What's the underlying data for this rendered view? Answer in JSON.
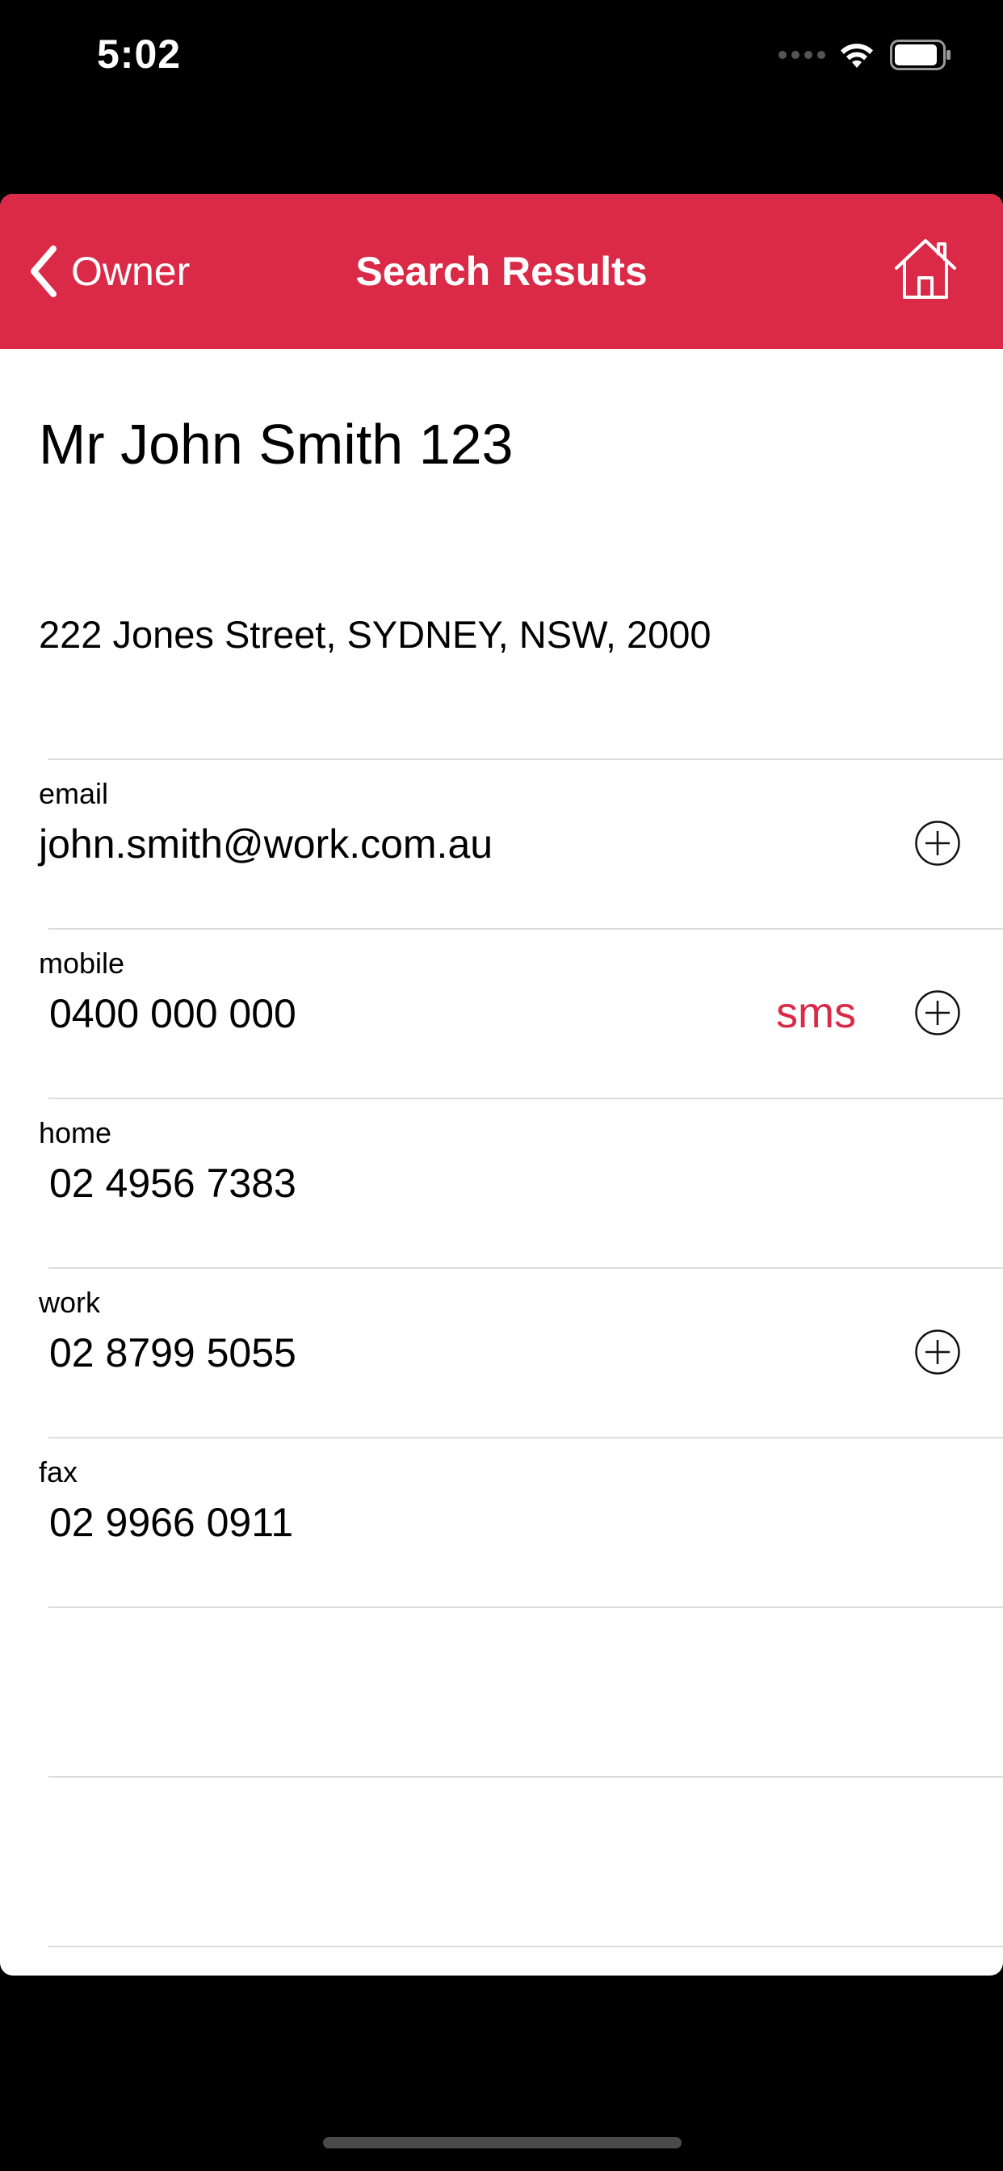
{
  "status_bar": {
    "time": "5:02"
  },
  "nav": {
    "back_label": "Owner",
    "title": "Search Results",
    "accent_color": "#da2a47"
  },
  "owner": {
    "name": "Mr John Smith 123",
    "address": "222 Jones Street, SYDNEY, NSW, 2000"
  },
  "contacts": {
    "email": {
      "label": "email",
      "value": "john.smith@work.com.au"
    },
    "mobile": {
      "label": "mobile",
      "value": "0400 000 000",
      "sms_label": "sms"
    },
    "home": {
      "label": "home",
      "value": "02 4956 7383"
    },
    "work": {
      "label": "work",
      "value": "02 8799 5055"
    },
    "fax": {
      "label": "fax",
      "value": "02 9966 0911"
    }
  },
  "icons": {
    "back": "chevron-left-icon",
    "home": "house-icon",
    "add": "plus-circle-icon",
    "wifi": "wifi-icon",
    "battery": "battery-icon"
  }
}
